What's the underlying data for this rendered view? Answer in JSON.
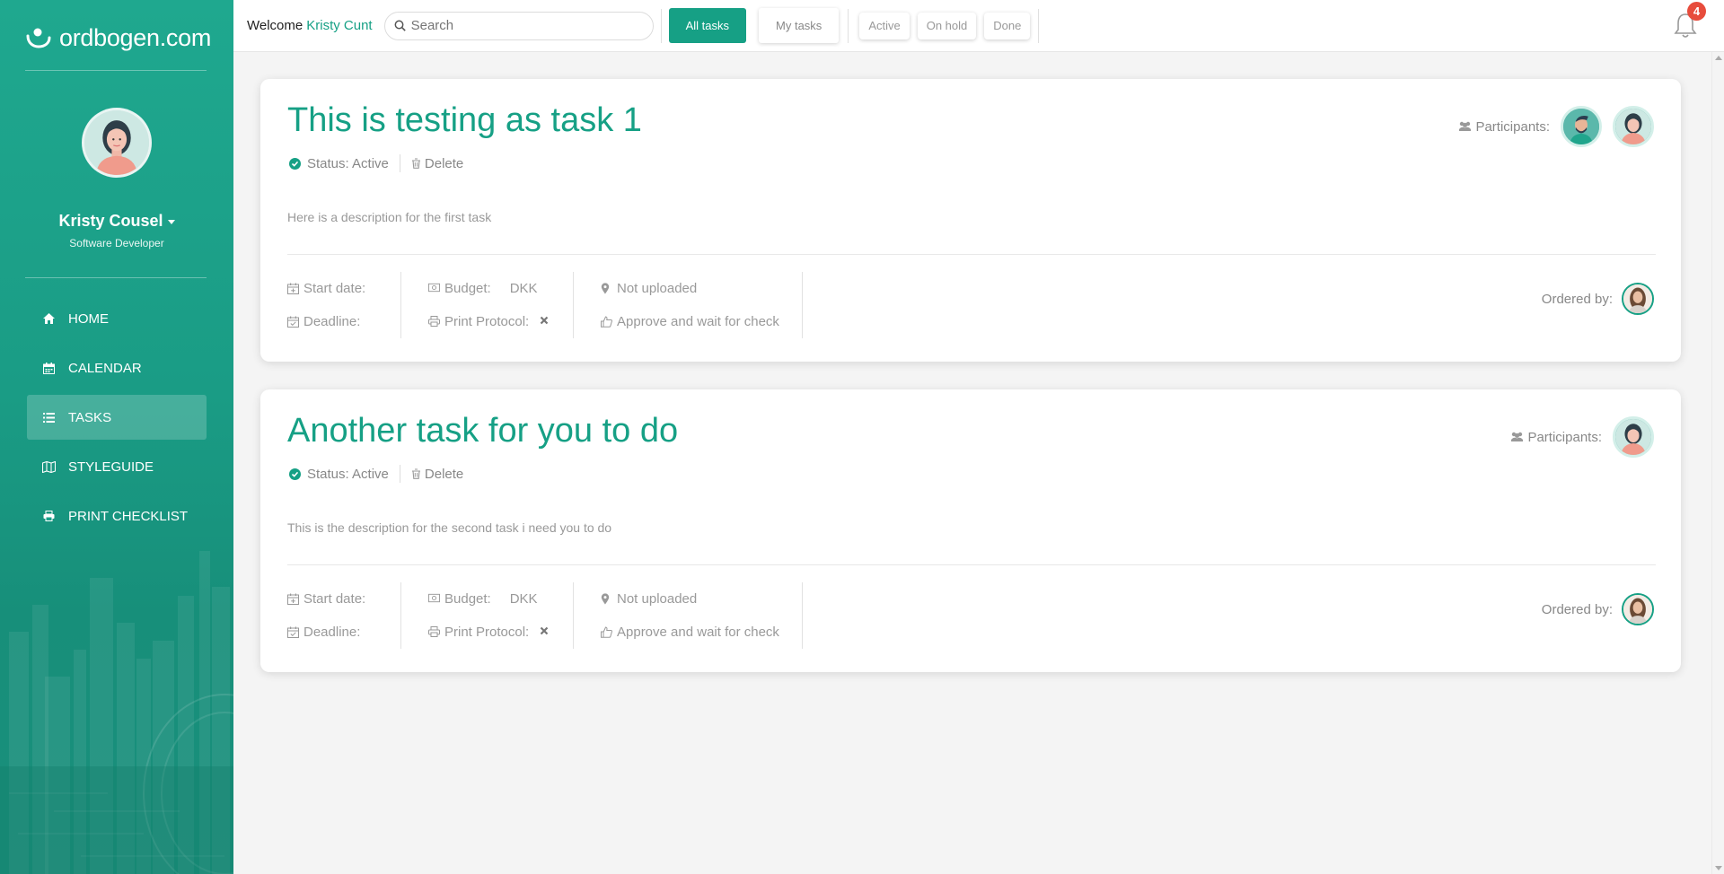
{
  "app": {
    "logo_text": "ordbogen.com"
  },
  "sidebar": {
    "user_name": "Kristy Cousel",
    "user_role": "Software Developer",
    "nav": [
      {
        "label": "HOME",
        "icon": "home-icon"
      },
      {
        "label": "CALENDAR",
        "icon": "calendar-icon"
      },
      {
        "label": "TASKS",
        "icon": "list-icon",
        "active": true
      },
      {
        "label": "STYLEGUIDE",
        "icon": "map-icon"
      },
      {
        "label": "PRINT CHECKLIST",
        "icon": "printer-icon"
      }
    ]
  },
  "topbar": {
    "welcome_label": "Welcome",
    "welcome_name": "Kristy Cunt",
    "search_placeholder": "Search",
    "tabs": {
      "all": "All tasks",
      "mine": "My tasks"
    },
    "filters": {
      "active": "Active",
      "on_hold": "On hold",
      "done": "Done"
    },
    "notification_count": "4"
  },
  "labels": {
    "status": "Status: Active",
    "delete": "Delete",
    "start_date": "Start date:",
    "deadline": "Deadline:",
    "budget": "Budget:",
    "currency": "DKK",
    "print_protocol": "Print Protocol:",
    "not_uploaded": "Not uploaded",
    "approve": "Approve and wait for check",
    "participants": "Participants:",
    "ordered_by": "Ordered by:"
  },
  "tasks": [
    {
      "title": "This is testing as task 1",
      "description": "Here is a description for the first task"
    },
    {
      "title": "Another task for you to do",
      "description": "This is the description for the second task i need you to do"
    }
  ],
  "colors": {
    "accent": "#16a085",
    "sidebar": "#1aa08a",
    "badge": "#e74c3c"
  }
}
